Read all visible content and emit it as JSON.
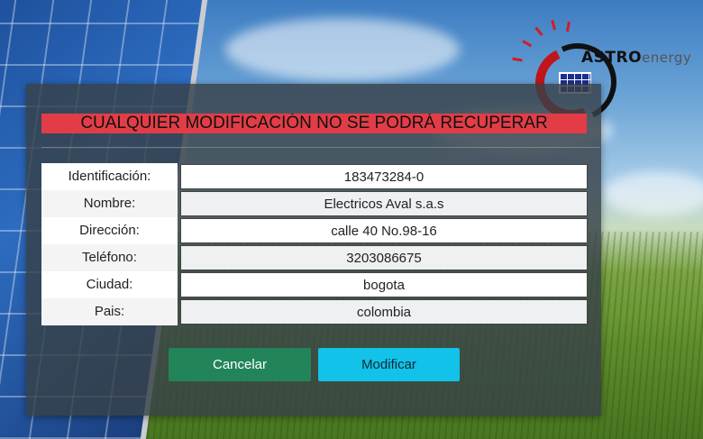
{
  "logo": {
    "brand_main": "ASTRO",
    "brand_suffix": "energy"
  },
  "dialog": {
    "warning": "CUALQUIER MODIFICACIÓN NO SE PODRÁ RECUPERAR",
    "fields": [
      {
        "label": "Identificación:",
        "value": "183473284-0"
      },
      {
        "label": "Nombre:",
        "value": "Electricos Aval s.a.s"
      },
      {
        "label": "Dirección:",
        "value": "calle 40 No.98-16"
      },
      {
        "label": "Teléfono:",
        "value": "3203086675"
      },
      {
        "label": "Ciudad:",
        "value": "bogota"
      },
      {
        "label": "Pais:",
        "value": "colombia"
      }
    ],
    "buttons": {
      "cancel": "Cancelar",
      "modify": "Modificar"
    }
  },
  "colors": {
    "warning_bg": "#e23d47",
    "cancel_bg": "#22855a",
    "modify_bg": "#12c2e8",
    "brand_red": "#c0151b"
  }
}
